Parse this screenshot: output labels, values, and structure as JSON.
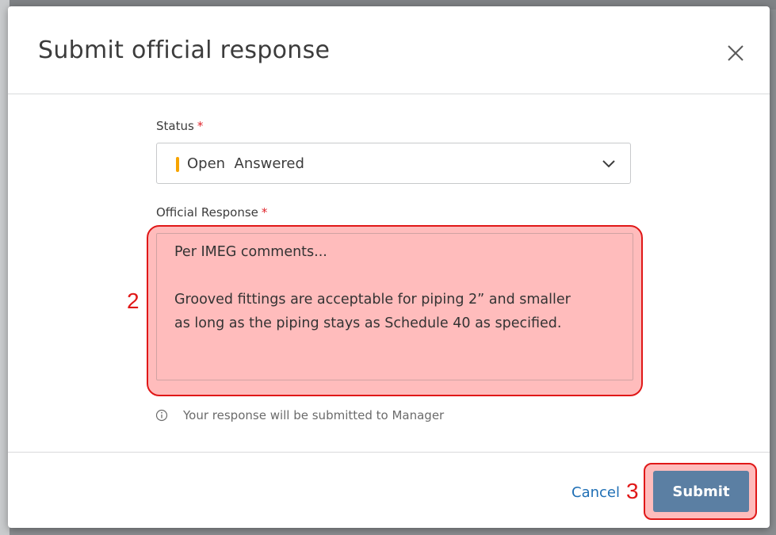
{
  "dialog": {
    "title": "Submit official response",
    "close_icon": "close-icon"
  },
  "status": {
    "label": "Status",
    "required_mark": "*",
    "indicator_color": "#f7a400",
    "value": "Open  Answered",
    "chevron_icon": "chevron-down-icon"
  },
  "response": {
    "label": "Official Response",
    "required_mark": "*",
    "lines": [
      "Per IMEG comments...",
      "",
      "Grooved fittings are acceptable for piping 2” and smaller",
      "as long as the piping stays as Schedule 40 as specified."
    ]
  },
  "helper": {
    "icon": "info-icon",
    "text": "Your response will be submitted to Manager"
  },
  "footer": {
    "cancel_label": "Cancel",
    "submit_label": "Submit"
  },
  "annotations": {
    "step_two": "2",
    "step_three": "3",
    "highlight_color": "#e01818"
  }
}
